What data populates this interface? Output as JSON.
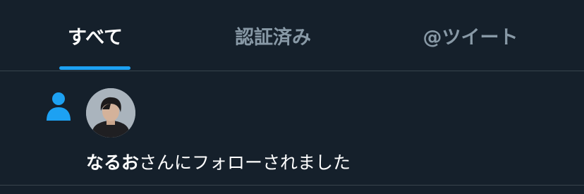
{
  "tabs": [
    {
      "label": "すべて",
      "active": true
    },
    {
      "label": "認証済み",
      "active": false
    },
    {
      "label": "@ツイート",
      "active": false
    }
  ],
  "notification": {
    "user_name": "なるお",
    "action_text": "さんにフォローされました",
    "type_icon": "person-icon"
  },
  "colors": {
    "background": "#15202b",
    "divider": "#38444d",
    "accent": "#1da1f2",
    "inactive_text": "#8899a6",
    "text": "#ffffff"
  }
}
